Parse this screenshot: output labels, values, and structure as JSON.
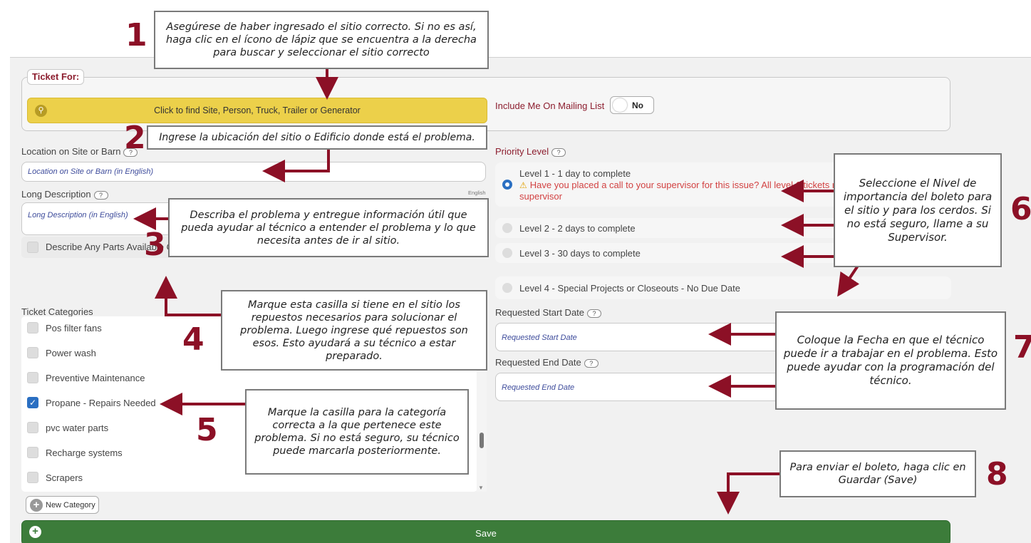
{
  "callouts": {
    "c1": "Asegúrese de haber ingresado el sitio correcto. Si no es así, haga clic en el ícono de lápiz que se encuentra a la derecha para buscar y seleccionar el sitio correcto",
    "c2": "Ingrese la ubicación del sitio o Edificio donde está el problema.",
    "c3": "Describa el problema y entregue información útil que pueda ayudar al técnico a entender el problema y lo que necesita antes de ir al sitio.",
    "c4": "Marque esta casilla si tiene en el sitio los repuestos necesarios para solucionar el problema. Luego ingrese qué repuestos son esos. Esto ayudará a su técnico a estar preparado.",
    "c5": "Marque la casilla para la categoría correcta a la que pertenece este problema. Si no está seguro, su técnico puede marcarla posteriormente.",
    "c6": "Seleccione el Nivel de importancia del boleto para el sitio y para los cerdos. Si no está seguro, llame a su Supervisor.",
    "c7": "Coloque la Fecha en que el técnico puede ir a trabajar en el problema. Esto puede ayudar con la programación del técnico.",
    "c8": "Para enviar el boleto, haga clic en Guardar (Save)"
  },
  "numbers": {
    "n1": "1",
    "n2": "2",
    "n3": "3",
    "n4": "4",
    "n5": "5",
    "n6": "6",
    "n7": "7",
    "n8": "8"
  },
  "ticket_for": {
    "legend": "Ticket For:",
    "find_button": "Click to find Site, Person, Truck, Trailer or Generator",
    "icon": "search-icon",
    "mailing_label": "Include Me On Mailing List",
    "mailing_value": "No"
  },
  "location": {
    "label": "Location on Site or Barn",
    "placeholder": "Location on Site or Barn (in English)",
    "lang_note": "English"
  },
  "long_description": {
    "label": "Long Description",
    "placeholder": "Long Description (in English)"
  },
  "help_glyph": "?",
  "parts": {
    "label": "Describe Any Parts Available On Farm",
    "checked": false
  },
  "categories": {
    "label": "Ticket Categories",
    "items": [
      {
        "label": "Pos filter fans",
        "checked": false
      },
      {
        "label": "Power wash",
        "checked": false
      },
      {
        "label": "Preventive Maintenance",
        "checked": false
      },
      {
        "label": "Propane - Repairs Needed",
        "checked": true
      },
      {
        "label": "pvc water parts",
        "checked": false
      },
      {
        "label": "Recharge systems",
        "checked": false
      },
      {
        "label": "Scrapers",
        "checked": false
      }
    ],
    "new_button": "New Category"
  },
  "priority": {
    "label": "Priority Level",
    "levels": [
      {
        "label": "Level 1 - 1 day to complete",
        "selected": true
      },
      {
        "label": "Level 2 - 2 days to complete",
        "selected": false
      },
      {
        "label": "Level 3 - 30 days to complete",
        "selected": false
      },
      {
        "label": "Level 4 - Special Projects or Closeouts - No Due Date",
        "selected": false
      }
    ],
    "warning_line1": "Have you placed a call to your supervisor for this issue? All level 1 tickets r",
    "warning_line2": "supervisor"
  },
  "dates": {
    "start_label": "Requested Start Date",
    "start_placeholder": "Requested Start Date",
    "end_label": "Requested End Date",
    "end_placeholder": "Requested End Date"
  },
  "save": {
    "label": "Save",
    "icon": "plus-icon"
  },
  "colors": {
    "accent": "#8c1026",
    "find_bar": "#ecd04a",
    "save_bar": "#3c7c3a",
    "check": "#2a6fc2",
    "warning": "#d24242"
  }
}
